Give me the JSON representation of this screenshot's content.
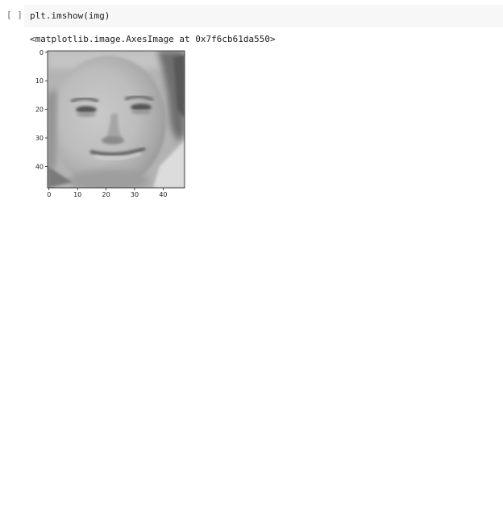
{
  "cell": {
    "run_indicator": "[ ]",
    "code": "plt.imshow(img)",
    "output_repr": "<matplotlib.image.AxesImage at 0x7f6cb61da550>"
  },
  "chart_data": {
    "type": "heatmap",
    "colormap": "gray",
    "image_shape": [
      48,
      48
    ],
    "xticks": [
      "0",
      "10",
      "20",
      "30",
      "40"
    ],
    "yticks": [
      "0",
      "10",
      "20",
      "30",
      "40"
    ],
    "xlim": [
      -0.5,
      47.5
    ],
    "ylim": [
      47.5,
      -0.5
    ],
    "description_note": ""
  }
}
